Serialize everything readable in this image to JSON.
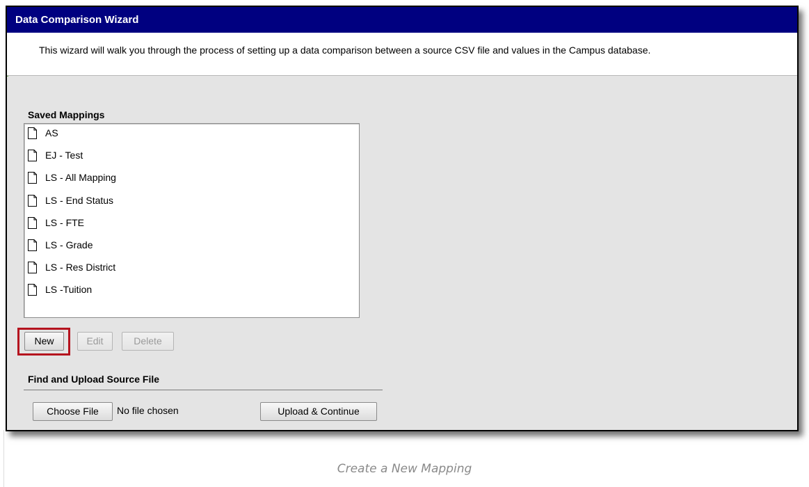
{
  "window": {
    "title": "Data Comparison Wizard",
    "intro": "This wizard will walk you through the process of setting up a data comparison between a source CSV file and values in the Campus database."
  },
  "saved_mappings": {
    "label": "Saved Mappings",
    "items": [
      {
        "label": "AS",
        "icon": "document-icon"
      },
      {
        "label": "EJ - Test",
        "icon": "document-icon"
      },
      {
        "label": "LS - All Mapping",
        "icon": "document-icon"
      },
      {
        "label": "LS - End Status",
        "icon": "document-icon"
      },
      {
        "label": "LS - FTE",
        "icon": "document-icon"
      },
      {
        "label": "LS - Grade",
        "icon": "document-icon"
      },
      {
        "label": "LS - Res District",
        "icon": "document-icon"
      },
      {
        "label": "LS -Tuition",
        "icon": "document-icon"
      }
    ],
    "buttons": {
      "new": "New",
      "edit": "Edit",
      "delete": "Delete"
    },
    "highlight_color": "#b5131e"
  },
  "upload": {
    "label": "Find and Upload Source File",
    "choose_file": "Choose File",
    "file_status": "No file chosen",
    "upload_continue": "Upload & Continue"
  },
  "caption": "Create a New Mapping",
  "colors": {
    "title_bar": "#000080",
    "panel_background": "#e4e4e4"
  }
}
